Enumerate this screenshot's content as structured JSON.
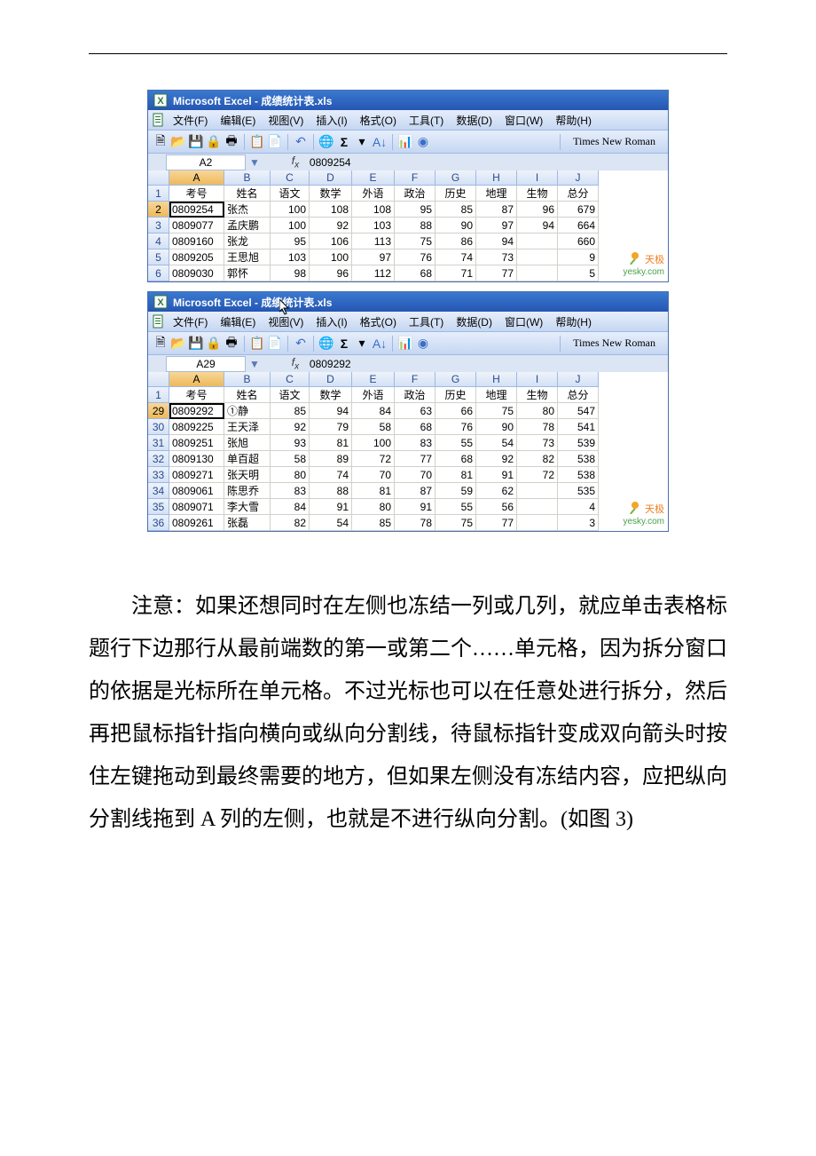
{
  "excel": {
    "titlebar": "Microsoft Excel - 成绩统计表.xls",
    "menus": [
      "文件(F)",
      "编辑(E)",
      "视图(V)",
      "插入(I)",
      "格式(O)",
      "工具(T)",
      "数据(D)",
      "窗口(W)",
      "帮助(H)"
    ],
    "font_name": "Times New Roman",
    "col_letters": [
      "A",
      "B",
      "C",
      "D",
      "E",
      "F",
      "G",
      "H",
      "I",
      "J"
    ]
  },
  "pane1": {
    "name_box": "A2",
    "formula": "0809254",
    "header_rownum": "1",
    "headers": [
      "考号",
      "姓名",
      "语文",
      "数学",
      "外语",
      "政治",
      "历史",
      "地理",
      "生物",
      "总分"
    ],
    "rows": [
      {
        "n": "2",
        "d": [
          "0809254",
          "张杰",
          "100",
          "108",
          "108",
          "95",
          "85",
          "87",
          "96",
          "679"
        ]
      },
      {
        "n": "3",
        "d": [
          "0809077",
          "孟庆鹏",
          "100",
          "92",
          "103",
          "88",
          "90",
          "97",
          "94",
          "664"
        ]
      },
      {
        "n": "4",
        "d": [
          "0809160",
          "张龙",
          "95",
          "106",
          "113",
          "75",
          "86",
          "94",
          "",
          "660"
        ]
      },
      {
        "n": "5",
        "d": [
          "0809205",
          "王思旭",
          "103",
          "100",
          "97",
          "76",
          "74",
          "73",
          "",
          "9"
        ]
      },
      {
        "n": "6",
        "d": [
          "0809030",
          "郭怀",
          "98",
          "96",
          "112",
          "68",
          "71",
          "77",
          "",
          "5"
        ]
      }
    ],
    "watermark_brand": "天极",
    "watermark_site": "yesky.com"
  },
  "pane2": {
    "name_box": "A29",
    "formula": "0809292",
    "header_rownum": "1",
    "headers": [
      "考号",
      "姓名",
      "语文",
      "数学",
      "外语",
      "政治",
      "历史",
      "地理",
      "生物",
      "总分"
    ],
    "rows": [
      {
        "n": "29",
        "d": [
          "0809292",
          "①静",
          "85",
          "94",
          "84",
          "63",
          "66",
          "75",
          "80",
          "547"
        ]
      },
      {
        "n": "30",
        "d": [
          "0809225",
          "王天泽",
          "92",
          "79",
          "58",
          "68",
          "76",
          "90",
          "78",
          "541"
        ]
      },
      {
        "n": "31",
        "d": [
          "0809251",
          "张旭",
          "93",
          "81",
          "100",
          "83",
          "55",
          "54",
          "73",
          "539"
        ]
      },
      {
        "n": "32",
        "d": [
          "0809130",
          "单百超",
          "58",
          "89",
          "72",
          "77",
          "68",
          "92",
          "82",
          "538"
        ]
      },
      {
        "n": "33",
        "d": [
          "0809271",
          "张天明",
          "80",
          "74",
          "70",
          "70",
          "81",
          "91",
          "72",
          "538"
        ]
      },
      {
        "n": "34",
        "d": [
          "0809061",
          "陈思乔",
          "83",
          "88",
          "81",
          "87",
          "59",
          "62",
          "",
          "535"
        ]
      },
      {
        "n": "35",
        "d": [
          "0809071",
          "李大雪",
          "84",
          "91",
          "80",
          "91",
          "55",
          "56",
          "",
          "4"
        ]
      },
      {
        "n": "36",
        "d": [
          "0809261",
          "张磊",
          "82",
          "54",
          "85",
          "78",
          "75",
          "77",
          "",
          "3"
        ]
      }
    ],
    "watermark_brand": "天极",
    "watermark_site": "yesky.com"
  },
  "body_paragraph": "注意：如果还想同时在左侧也冻结一列或几列，就应单击表格标题行下边那行从最前端数的第一或第二个……单元格，因为拆分窗口的依据是光标所在单元格。不过光标也可以在任意处进行拆分，然后再把鼠标指针指向横向或纵向分割线，待鼠标指针变成双向箭头时按住左键拖动到最终需要的地方，但如果左侧没有冻结内容，应把纵向分割线拖到 A 列的左侧，也就是不进行纵向分割。(如图 3)"
}
